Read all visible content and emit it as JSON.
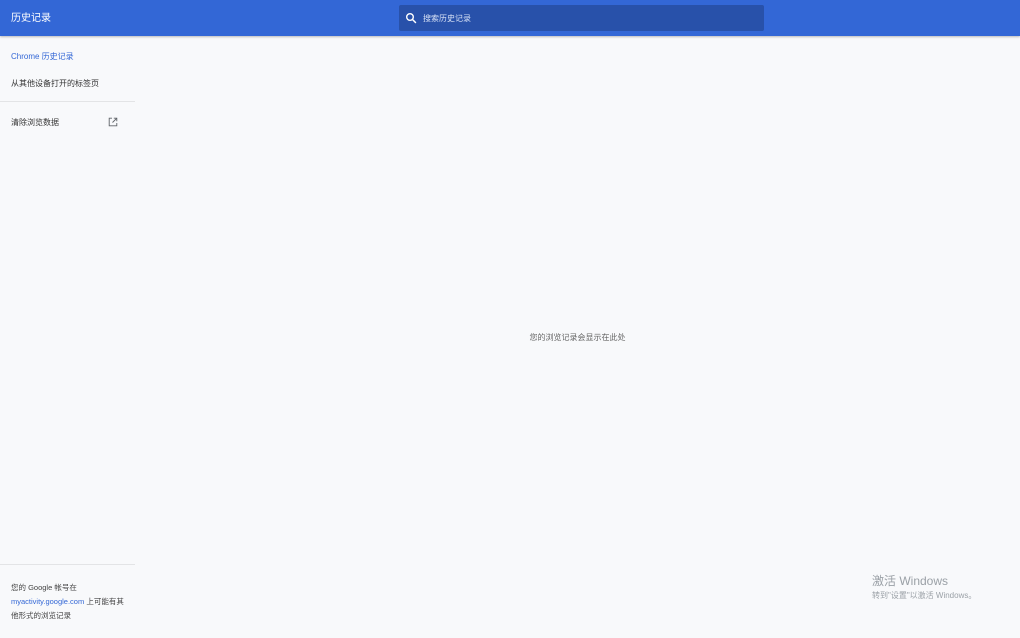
{
  "header": {
    "title": "历史记录",
    "search": {
      "placeholder": "搜索历史记录",
      "value": ""
    }
  },
  "sidebar": {
    "items": [
      {
        "label": "Chrome 历史记录",
        "active": true
      },
      {
        "label": "从其他设备打开的标签页",
        "active": false
      },
      {
        "label": "清除浏览数据",
        "active": false,
        "icon": "external-link-icon"
      }
    ],
    "footer": {
      "prefix": "您的 Google 帐号在",
      "link": "myactivity.google.com",
      "suffix": "上可能有其他形式的浏览记录"
    }
  },
  "main": {
    "empty_message": "您的浏览记录会显示在此处"
  },
  "watermark": {
    "title": "激活 Windows",
    "subtitle": "转到\"设置\"以激活 Windows。"
  },
  "colors": {
    "header_bg": "#3367d6",
    "search_bg": "#2851aa",
    "accent": "#3367d6",
    "page_bg": "#f8f9fb"
  }
}
